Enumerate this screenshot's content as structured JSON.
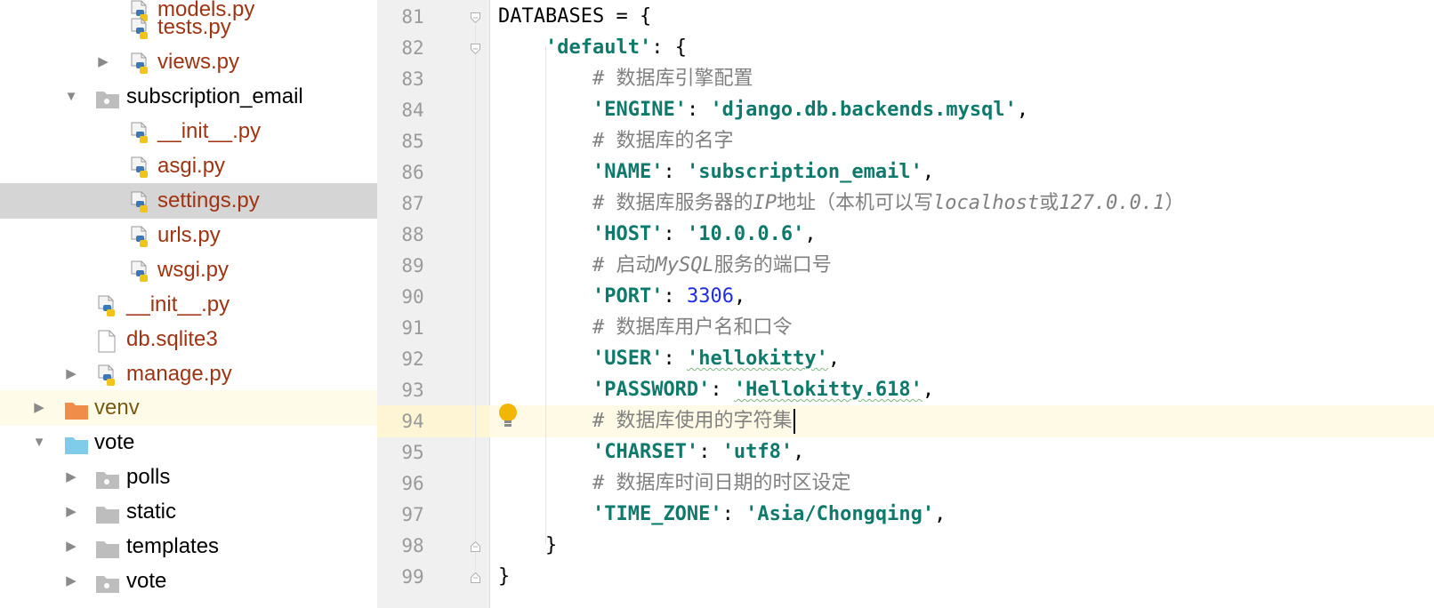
{
  "project_tree": {
    "items": [
      {
        "label": "models.py",
        "kind": "py",
        "level": 2,
        "arrow": "none",
        "selected": false
      },
      {
        "label": "tests.py",
        "kind": "py",
        "level": 2,
        "arrow": "none",
        "selected": false
      },
      {
        "label": "views.py",
        "kind": "py",
        "level": 2,
        "arrow": "collapsed",
        "selected": false
      },
      {
        "label": "subscription_email",
        "kind": "package",
        "level": 1,
        "arrow": "expanded",
        "selected": false
      },
      {
        "label": "__init__.py",
        "kind": "py",
        "level": 2,
        "arrow": "none",
        "selected": false
      },
      {
        "label": "asgi.py",
        "kind": "py",
        "level": 2,
        "arrow": "none",
        "selected": false
      },
      {
        "label": "settings.py",
        "kind": "py",
        "level": 2,
        "arrow": "none",
        "selected": true
      },
      {
        "label": "urls.py",
        "kind": "py",
        "level": 2,
        "arrow": "none",
        "selected": false
      },
      {
        "label": "wsgi.py",
        "kind": "py",
        "level": 2,
        "arrow": "none",
        "selected": false
      },
      {
        "label": "__init__.py",
        "kind": "py",
        "level": 1,
        "arrow": "none",
        "selected": false
      },
      {
        "label": "db.sqlite3",
        "kind": "file",
        "level": 1,
        "arrow": "none",
        "selected": false
      },
      {
        "label": "manage.py",
        "kind": "py",
        "level": 1,
        "arrow": "collapsed",
        "selected": false
      },
      {
        "label": "venv",
        "kind": "excluded-folder",
        "level": 0,
        "arrow": "collapsed",
        "selected": false
      },
      {
        "label": "vote",
        "kind": "source-folder",
        "level": 0,
        "arrow": "expanded",
        "selected": false
      },
      {
        "label": "polls",
        "kind": "package",
        "level": 1,
        "arrow": "collapsed",
        "selected": false
      },
      {
        "label": "static",
        "kind": "folder",
        "level": 1,
        "arrow": "collapsed",
        "selected": false
      },
      {
        "label": "templates",
        "kind": "folder",
        "level": 1,
        "arrow": "collapsed",
        "selected": false
      },
      {
        "label": "vote",
        "kind": "package",
        "level": 1,
        "arrow": "collapsed",
        "selected": false
      }
    ]
  },
  "editor": {
    "current_line": 94,
    "lines": [
      {
        "n": "81",
        "tokens": [
          {
            "t": "DATABASES = {",
            "c": "plain"
          }
        ]
      },
      {
        "n": "82",
        "tokens": [
          {
            "t": "    ",
            "c": "plain"
          },
          {
            "t": "'default'",
            "c": "key"
          },
          {
            "t": ": {",
            "c": "plain"
          }
        ]
      },
      {
        "n": "83",
        "tokens": [
          {
            "t": "        # 数据库引擎配置",
            "c": "cmt"
          }
        ]
      },
      {
        "n": "84",
        "tokens": [
          {
            "t": "        ",
            "c": "plain"
          },
          {
            "t": "'ENGINE'",
            "c": "key"
          },
          {
            "t": ": ",
            "c": "plain"
          },
          {
            "t": "'django.db.backends.mysql'",
            "c": "key"
          },
          {
            "t": ",",
            "c": "plain"
          }
        ]
      },
      {
        "n": "85",
        "tokens": [
          {
            "t": "        # 数据库的名字",
            "c": "cmt"
          }
        ]
      },
      {
        "n": "86",
        "tokens": [
          {
            "t": "        ",
            "c": "plain"
          },
          {
            "t": "'NAME'",
            "c": "key"
          },
          {
            "t": ": ",
            "c": "plain"
          },
          {
            "t": "'subscription_email'",
            "c": "key"
          },
          {
            "t": ",",
            "c": "plain"
          }
        ]
      },
      {
        "n": "87",
        "tokens": [
          {
            "t": "        # 数据库服务器的",
            "c": "cmt"
          },
          {
            "t": "IP",
            "c": "cmt-i"
          },
          {
            "t": "地址（本机可以写",
            "c": "cmt"
          },
          {
            "t": "localhost",
            "c": "cmt-i"
          },
          {
            "t": "或",
            "c": "cmt"
          },
          {
            "t": "127.0.0.1",
            "c": "cmt-i"
          },
          {
            "t": "）",
            "c": "cmt"
          }
        ]
      },
      {
        "n": "88",
        "tokens": [
          {
            "t": "        ",
            "c": "plain"
          },
          {
            "t": "'HOST'",
            "c": "key"
          },
          {
            "t": ": ",
            "c": "plain"
          },
          {
            "t": "'10.0.0.6'",
            "c": "key"
          },
          {
            "t": ",",
            "c": "plain"
          }
        ]
      },
      {
        "n": "89",
        "tokens": [
          {
            "t": "        # 启动",
            "c": "cmt"
          },
          {
            "t": "MySQL",
            "c": "cmt-i"
          },
          {
            "t": "服务的端口号",
            "c": "cmt"
          }
        ]
      },
      {
        "n": "90",
        "tokens": [
          {
            "t": "        ",
            "c": "plain"
          },
          {
            "t": "'PORT'",
            "c": "key"
          },
          {
            "t": ": ",
            "c": "plain"
          },
          {
            "t": "3306",
            "c": "num"
          },
          {
            "t": ",",
            "c": "plain"
          }
        ]
      },
      {
        "n": "91",
        "tokens": [
          {
            "t": "        # 数据库用户名和口令",
            "c": "cmt"
          }
        ]
      },
      {
        "n": "92",
        "tokens": [
          {
            "t": "        ",
            "c": "plain"
          },
          {
            "t": "'USER'",
            "c": "key"
          },
          {
            "t": ": ",
            "c": "plain"
          },
          {
            "t": "'hellokitty'",
            "c": "key-squig"
          },
          {
            "t": ",",
            "c": "plain"
          }
        ]
      },
      {
        "n": "93",
        "tokens": [
          {
            "t": "        ",
            "c": "plain"
          },
          {
            "t": "'PASSWORD'",
            "c": "key"
          },
          {
            "t": ": ",
            "c": "plain"
          },
          {
            "t": "'Hellokitty.618'",
            "c": "key-squig"
          },
          {
            "t": ",",
            "c": "plain"
          }
        ]
      },
      {
        "n": "94",
        "tokens": [
          {
            "t": "        # 数据库使用的字符集",
            "c": "cmt"
          }
        ]
      },
      {
        "n": "95",
        "tokens": [
          {
            "t": "        ",
            "c": "plain"
          },
          {
            "t": "'CHARSET'",
            "c": "key"
          },
          {
            "t": ": ",
            "c": "plain"
          },
          {
            "t": "'utf8'",
            "c": "key"
          },
          {
            "t": ",",
            "c": "plain"
          }
        ]
      },
      {
        "n": "96",
        "tokens": [
          {
            "t": "        # 数据库时间日期的时区设定",
            "c": "cmt"
          }
        ]
      },
      {
        "n": "97",
        "tokens": [
          {
            "t": "        ",
            "c": "plain"
          },
          {
            "t": "'TIME_ZONE'",
            "c": "key"
          },
          {
            "t": ": ",
            "c": "plain"
          },
          {
            "t": "'Asia/Chongqing'",
            "c": "key"
          },
          {
            "t": ",",
            "c": "plain"
          }
        ]
      },
      {
        "n": "98",
        "tokens": [
          {
            "t": "    }",
            "c": "plain"
          }
        ]
      },
      {
        "n": "99",
        "tokens": [
          {
            "t": "}",
            "c": "plain"
          }
        ]
      }
    ]
  },
  "colors": {
    "selection": "#d5d5d5",
    "current_line": "#fefae5",
    "string_key": "#0e7a6b",
    "number": "#1f2cdf",
    "comment": "#808080",
    "py_file_label": "#a03412"
  },
  "icons": {
    "python_file": "python-file-icon",
    "package": "package-folder-icon",
    "folder": "folder-icon",
    "excluded_folder": "excluded-folder-icon",
    "source_folder": "source-folder-icon",
    "text_file": "text-file-icon",
    "intention": "lightbulb-icon"
  }
}
